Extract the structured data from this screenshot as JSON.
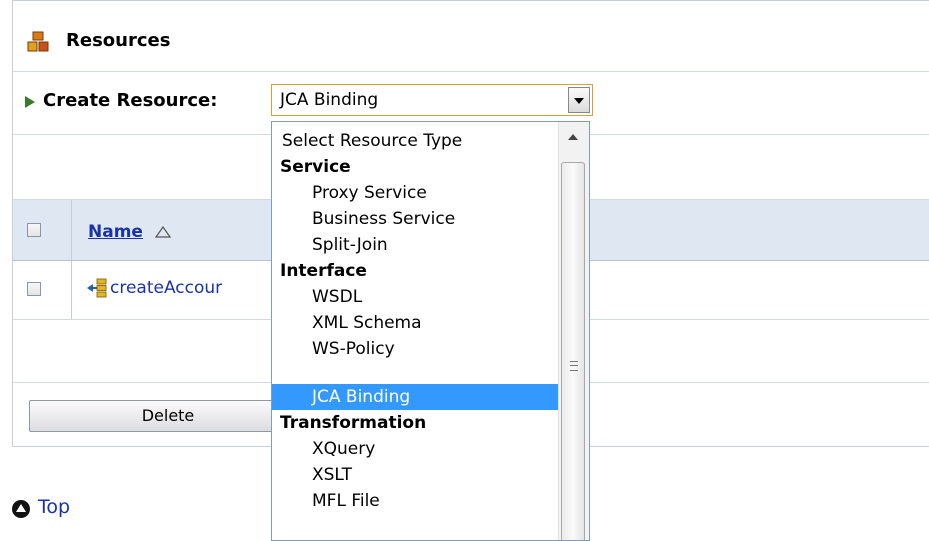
{
  "resources": {
    "title": "Resources",
    "create_label": "Create Resource:",
    "selected_type": "JCA Binding"
  },
  "table": {
    "name_header": "Name",
    "rows": [
      {
        "name": "createAccour"
      }
    ]
  },
  "actions": {
    "delete_label": "Delete"
  },
  "footer": {
    "top_label": "Top"
  },
  "dropdown": {
    "options": [
      {
        "label": "Select Resource Type"
      },
      {
        "label": "Service"
      },
      {
        "label": "Proxy Service"
      },
      {
        "label": "Business Service"
      },
      {
        "label": "Split-Join"
      },
      {
        "label": "Interface"
      },
      {
        "label": "WSDL"
      },
      {
        "label": "XML Schema"
      },
      {
        "label": "WS-Policy"
      },
      {
        "label": "JCA Binding"
      },
      {
        "label": "Transformation"
      },
      {
        "label": "XQuery"
      },
      {
        "label": "XSLT"
      },
      {
        "label": "MFL File"
      }
    ]
  },
  "colors": {
    "link": "#1a33a8",
    "selected_option_bg": "#3399ff",
    "table_header_bg": "#dfe7f2",
    "select_border": "#d8a030"
  }
}
